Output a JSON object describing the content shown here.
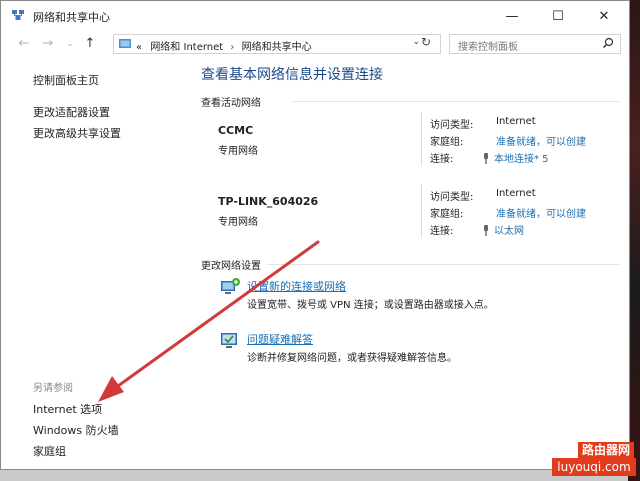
{
  "window": {
    "title": "网络和共享中心",
    "controls": {
      "minimize": "—",
      "maximize": "☐",
      "close": "✕"
    }
  },
  "address": {
    "prefix": "«",
    "crumb1": "网络和 Internet",
    "separator": "›",
    "crumb2": "网络和共享中心",
    "dropdown": "⌄",
    "refresh": "↻"
  },
  "nav": {
    "back": "←",
    "forward": "→",
    "recent": "⌄",
    "up": "↑"
  },
  "search": {
    "placeholder": "搜索控制面板"
  },
  "sidebar": {
    "home": "控制面板主页",
    "adapter": "更改适配器设置",
    "advanced": "更改高级共享设置",
    "see_also": "另请参阅",
    "internet_options": "Internet 选项",
    "firewall": "Windows 防火墙",
    "homegroup": "家庭组"
  },
  "main": {
    "title": "查看基本网络信息并设置连接",
    "active_section": "查看活动网络",
    "networks": [
      {
        "name": "CCMC",
        "type": "专用网络",
        "access_label": "访问类型:",
        "access_value": "Internet",
        "homegroup_label": "家庭组:",
        "homegroup_value": "准备就绪，可以创建",
        "conn_label": "连接:",
        "conn_value": "本地连接* 5"
      },
      {
        "name": "TP-LINK_604026",
        "type": "专用网络",
        "access_label": "访问类型:",
        "access_value": "Internet",
        "homegroup_label": "家庭组:",
        "homegroup_value": "准备就绪，可以创建",
        "conn_label": "连接:",
        "conn_value": "以太网"
      }
    ],
    "change_section": "更改网络设置",
    "tasks": [
      {
        "link": "设置新的连接或网络",
        "desc": "设置宽带、拨号或 VPN 连接；或设置路由器或接入点。"
      },
      {
        "link": "问题疑难解答",
        "desc": "诊断并修复网络问题，或者获得疑难解答信息。"
      }
    ]
  },
  "watermark": {
    "line1": "路由器网",
    "line2": "luyouqi.com"
  },
  "colors": {
    "link": "#1a6fb5",
    "title": "#1a4a8a",
    "arrow": "#d23a3a",
    "watermark": "#e23c1c"
  }
}
